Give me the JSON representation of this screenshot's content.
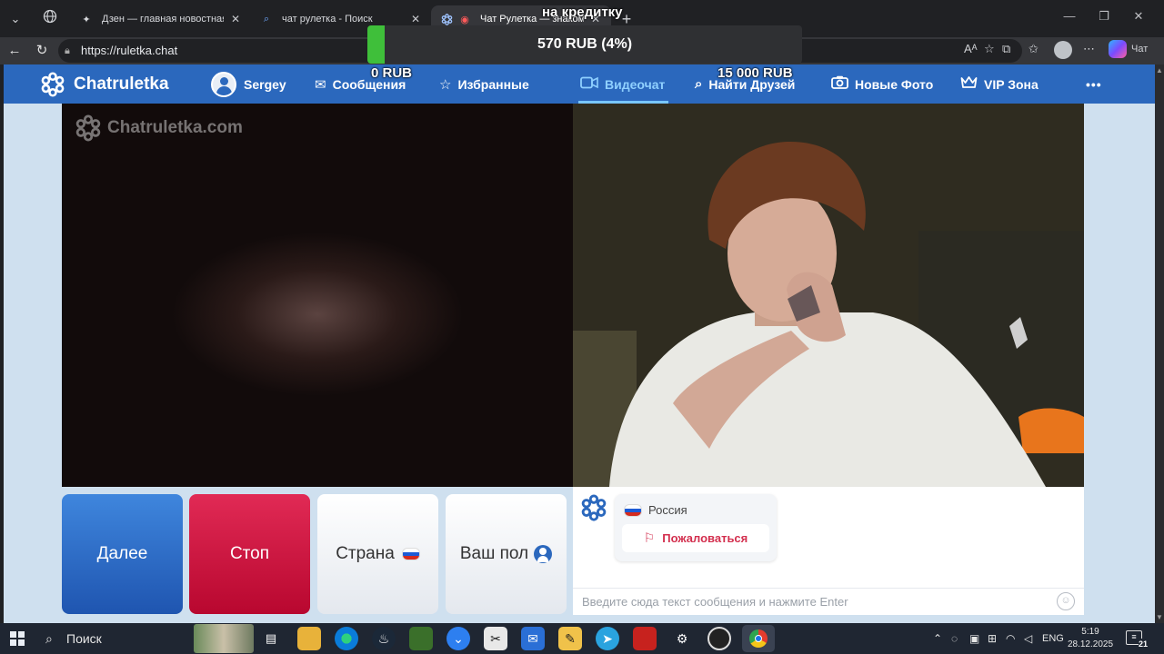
{
  "browser": {
    "tabs": [
      {
        "title": "Дзен — главная новостная информационная",
        "icon": "sparkle-icon",
        "active": false
      },
      {
        "title": "чат рулетка - Поиск",
        "icon": "search-icon",
        "active": false
      },
      {
        "title": "Чат Рулетка — знакомства и",
        "icon": "chatruletka-favicon",
        "active": true
      }
    ],
    "url": "https://ruletka.chat",
    "copilot_label": "Чат"
  },
  "overlay": {
    "goal_top_label": "на кредитку",
    "goal_amount": "570 RUB (4%)",
    "goal_progress_fraction": 0.04,
    "goal_min": "0 RUB",
    "goal_max": "15 000 RUB"
  },
  "site": {
    "brand": "Chatruletka",
    "nav": {
      "user": "Sergey",
      "messages": "Сообщения",
      "favorites": "Избранные",
      "videochat": "Видеочат",
      "find_friends": "Найти Друзей",
      "new_photos": "Новые Фото",
      "vip": "VIP Зона",
      "more": "•••"
    },
    "watermark": "Chatruletka.com",
    "controls": {
      "next": "Далее",
      "stop": "Стоп",
      "country": "Страна",
      "gender": "Ваш пол"
    },
    "chat": {
      "partner_country": "Россия",
      "report": "Пожаловаться",
      "input_placeholder": "Введите сюда текст сообщения и нажмите Enter"
    }
  },
  "taskbar": {
    "search": "Поиск",
    "language": "ENG",
    "time": "5:19",
    "date": "28.12.2025",
    "notifications": "21"
  }
}
